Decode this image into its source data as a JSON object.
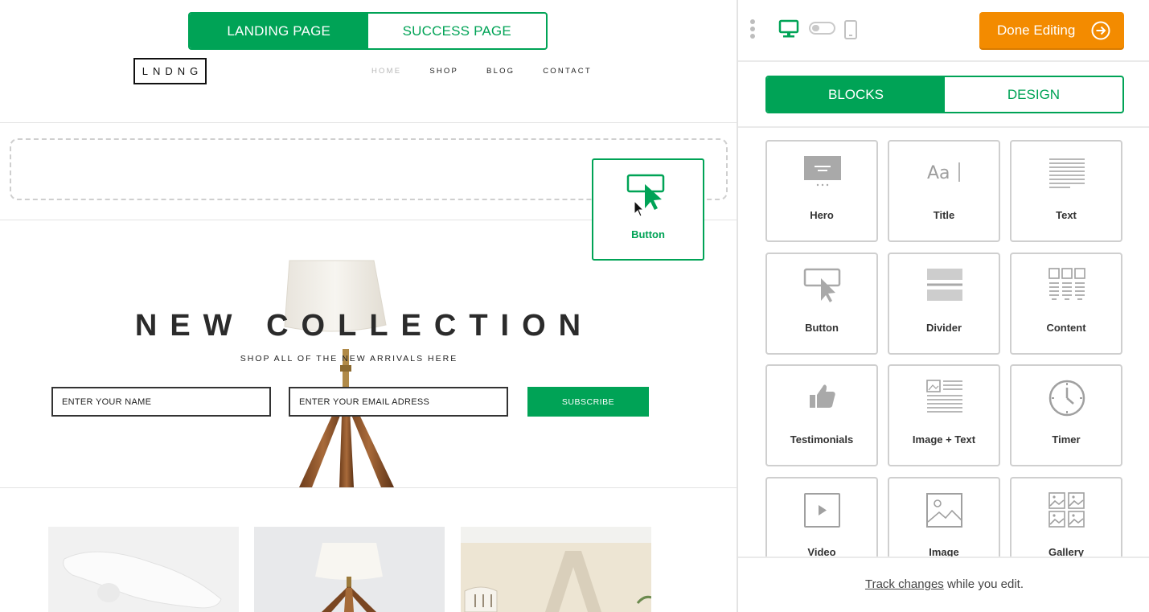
{
  "page_tabs": {
    "landing": "LANDING PAGE",
    "success": "SUCCESS PAGE"
  },
  "site": {
    "logo": "LNDNG",
    "nav": [
      "HOME",
      "SHOP",
      "BLOG",
      "CONTACT"
    ],
    "hero_title": "NEW COLLECTION",
    "hero_subtitle": "SHOP ALL OF THE NEW ARRIVALS HERE",
    "name_placeholder": "ENTER YOUR NAME",
    "email_placeholder": "ENTER YOUR EMAIL ADRESS",
    "subscribe_label": "SUBSCRIBE"
  },
  "drag_ghost": {
    "label": "Button",
    "icon": "button-icon"
  },
  "panel": {
    "done_label": "Done Editing",
    "tabs": [
      "BLOCKS",
      "DESIGN"
    ],
    "blocks": [
      {
        "label": "Hero",
        "icon": "hero-icon"
      },
      {
        "label": "Title",
        "icon": "title-icon"
      },
      {
        "label": "Text",
        "icon": "text-icon"
      },
      {
        "label": "Button",
        "icon": "button-icon"
      },
      {
        "label": "Divider",
        "icon": "divider-icon"
      },
      {
        "label": "Content",
        "icon": "content-icon"
      },
      {
        "label": "Testimonials",
        "icon": "thumbs-up-icon"
      },
      {
        "label": "Image + Text",
        "icon": "image-text-icon"
      },
      {
        "label": "Timer",
        "icon": "clock-icon"
      },
      {
        "label": "Video",
        "icon": "video-icon"
      },
      {
        "label": "Image",
        "icon": "image-icon"
      },
      {
        "label": "Gallery",
        "icon": "gallery-icon"
      }
    ],
    "footer_link": "Track changes",
    "footer_text": " while you edit."
  },
  "colors": {
    "accent": "#00a356",
    "orange": "#f38b00",
    "icon_gray": "#a9a9a9"
  }
}
